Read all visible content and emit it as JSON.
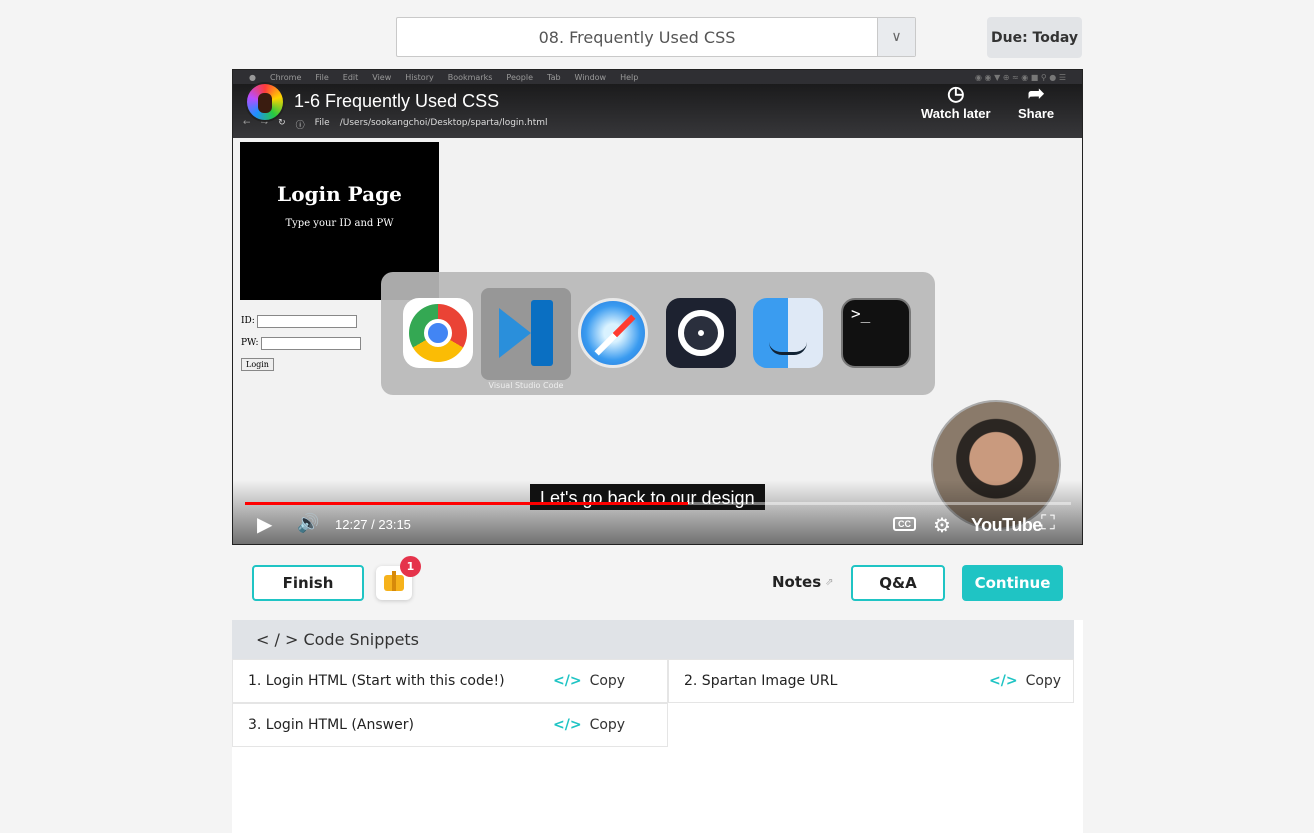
{
  "lesson_select": {
    "value": "08. Frequently Used CSS",
    "arrow_icon": "chevron-down-icon"
  },
  "due": {
    "label": "Due: Today"
  },
  "video": {
    "title": "1-6 Frequently Used CSS",
    "watch_later": "Watch later",
    "share": "Share",
    "menubar": [
      "Chrome",
      "File",
      "Edit",
      "View",
      "History",
      "Bookmarks",
      "People",
      "Tab",
      "Window",
      "Help"
    ],
    "url_file": "File",
    "url": "/Users/sookangchoi/Desktop/sparta/login.html",
    "login_heading": "Login Page",
    "login_sub": "Type your ID and PW",
    "id_label": "ID:",
    "pw_label": "PW:",
    "login_button": "Login",
    "vscode_label": "Visual Studio Code",
    "terminal_prompt": ">_",
    "subtitle": "Let's go back to our design",
    "time": "12:27 / 23:15",
    "progress": 0.536,
    "youtube": "YouTube",
    "colors": {
      "progress": "#ff0000"
    }
  },
  "actions": {
    "finish": "Finish",
    "badge_count": "1",
    "notes": "Notes",
    "qa": "Q&A",
    "continue": "Continue",
    "accent": "#1fc4c4"
  },
  "snippets": {
    "heading": "< / > Code Snippets",
    "copy_label": "Copy",
    "code_glyph": "</>",
    "items": [
      {
        "name": "1. Login HTML (Start with this code!)"
      },
      {
        "name": "2. Spartan Image URL"
      },
      {
        "name": "3. Login HTML (Answer)"
      }
    ]
  }
}
